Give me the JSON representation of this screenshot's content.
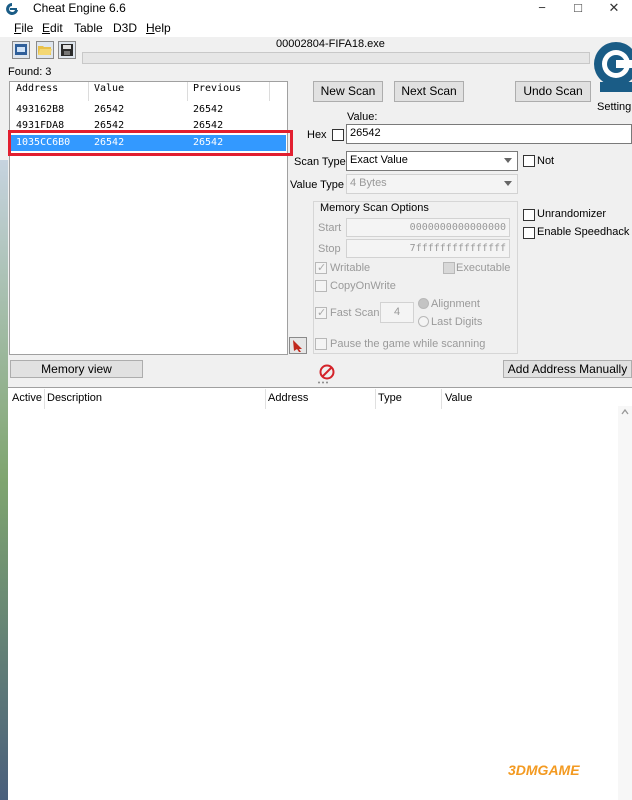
{
  "window": {
    "title": "Cheat Engine 6.6",
    "controls": [
      "−",
      "□",
      "✕"
    ]
  },
  "menu": {
    "items": [
      {
        "label_pre": "",
        "label_u": "F",
        "label_post": "ile"
      },
      {
        "label_pre": "",
        "label_u": "E",
        "label_post": "dit"
      },
      {
        "label_pre": "Table",
        "label_u": "",
        "label_post": ""
      },
      {
        "label_pre": "D3D",
        "label_u": "",
        "label_post": ""
      },
      {
        "label_pre": "",
        "label_u": "H",
        "label_post": "elp"
      }
    ]
  },
  "toolbar": {
    "process_title": "00002804-FIFA18.exe",
    "icons": [
      "process-select-icon",
      "open-table-icon",
      "save-table-icon"
    ]
  },
  "found": "Found: 3",
  "results": {
    "headers": [
      "Address",
      "Value",
      "Previous"
    ],
    "rows": [
      {
        "address": "493162B8",
        "value": "26542",
        "previous": "26542"
      },
      {
        "address": "4931FDA8",
        "value": "26542",
        "previous": "26542"
      },
      {
        "address": "1035CC6B0",
        "value": "26542",
        "previous": "26542"
      }
    ],
    "selected_index": 2
  },
  "scan": {
    "new_scan": "New Scan",
    "next_scan": "Next Scan",
    "undo_scan": "Undo Scan",
    "settings": "Setting",
    "value_label": "Value:",
    "hex_label": "Hex",
    "value": "26542",
    "scan_type_label": "Scan Type",
    "scan_type": "Exact Value",
    "not_label": "Not",
    "value_type_label": "Value Type",
    "value_type": "4 Bytes"
  },
  "memory_scan_options": {
    "title": "Memory Scan Options",
    "start_label": "Start",
    "start": "0000000000000000",
    "stop_label": "Stop",
    "stop": "7fffffffffffffff",
    "writable": "Writable",
    "executable": "Executable",
    "copy_on_write": "CopyOnWrite",
    "fast_scan": "Fast Scan",
    "fast_scan_value": "4",
    "alignment": "Alignment",
    "last_digits": "Last Digits",
    "pause": "Pause the game while scanning"
  },
  "options": {
    "unrandomizer": "Unrandomizer",
    "speedhack": "Enable Speedhack"
  },
  "buttons": {
    "memory_view": "Memory view",
    "add_address": "Add Address Manually"
  },
  "address_list": {
    "headers": [
      "Active",
      "Description",
      "Address",
      "Type",
      "Value"
    ]
  },
  "watermark": "3DMGAME",
  "colors": {
    "selection": "#3399ff",
    "highlight_box": "#e21f30",
    "ce_logo": "#1a5c86"
  }
}
